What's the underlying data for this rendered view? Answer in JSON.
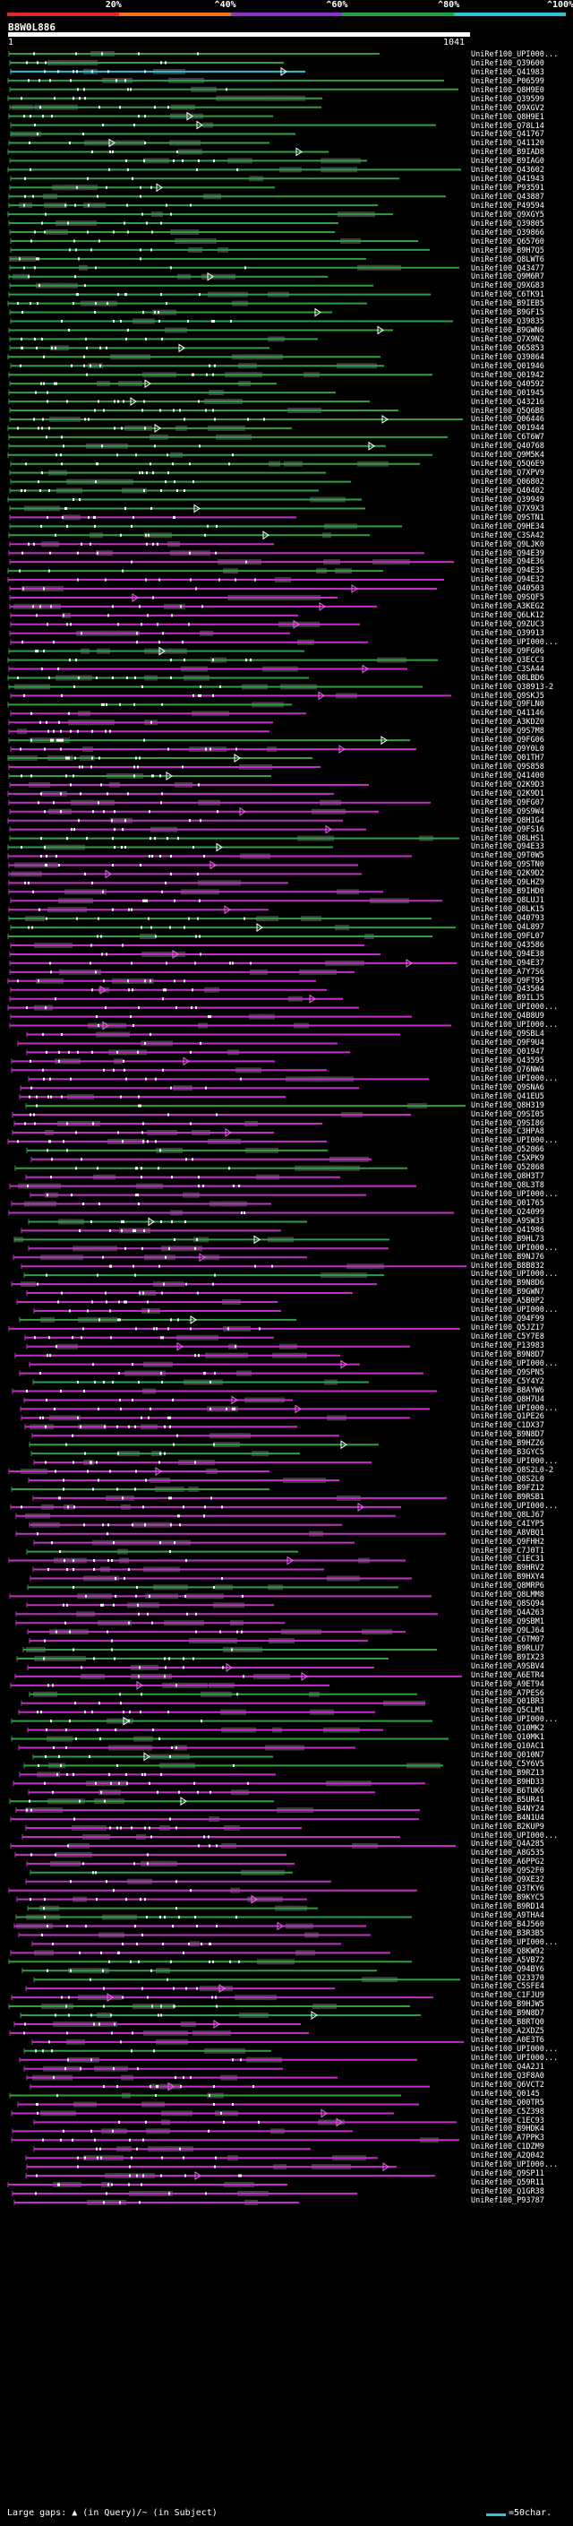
{
  "header": {
    "query_id": "B8W0L886",
    "start": "1",
    "end": "1041"
  },
  "scale": [
    {
      "label": "20%",
      "color": "#e8262a"
    },
    {
      "label": "^40%",
      "color": "#f07a16"
    },
    {
      "label": "^60%",
      "color": "#8a32c9"
    },
    {
      "label": "^80%",
      "color": "#1fa33a"
    },
    {
      "label": "^100%",
      "color": "#2bc6d6"
    }
  ],
  "colors": {
    "high_identity": "#2ea043",
    "low_identity": "#c32fc6",
    "top_hit": "#2bc6d6",
    "gap": "#3c3c3c"
  },
  "legend": {
    "gap_text": "Large gaps: ▲ (in Query)/~ (in Subject)",
    "scale_text": "=50char."
  },
  "hits": [
    "UniRef100_UPI000...",
    "UniRef100_Q39600",
    "UniRef100_Q41983",
    "UniRef100_P06599",
    "UniRef100_Q8H9E0",
    "UniRef100_Q39599",
    "UniRef100_Q9XGV2",
    "UniRef100_Q8H9E1",
    "UniRef100_Q78L14",
    "UniRef100_Q41767",
    "UniRef100_Q41120",
    "UniRef100_B9IAD8",
    "UniRef100_B9IAG0",
    "UniRef100_Q43602",
    "UniRef100_Q41943",
    "UniRef100_P93591",
    "UniRef100_Q43887",
    "UniRef100_P49594",
    "UniRef100_Q9XGY5",
    "UniRef100_Q39805",
    "UniRef100_Q39866",
    "UniRef100_Q65760",
    "UniRef100_B9H7Q5",
    "UniRef100_Q8LWT6",
    "UniRef100_Q43477",
    "UniRef100_Q9M6R7",
    "UniRef100_Q9XG83",
    "UniRef100_C6TK91",
    "UniRef100_B9IEB5",
    "UniRef100_B9GF15",
    "UniRef100_Q39835",
    "UniRef100_B9GWN6",
    "UniRef100_Q7X9N2",
    "UniRef100_Q65853",
    "UniRef100_Q39864",
    "UniRef100_Q01946",
    "UniRef100_Q01942",
    "UniRef100_Q40592",
    "UniRef100_Q01945",
    "UniRef100_Q43216",
    "UniRef100_Q5Q6B8",
    "UniRef100_Q06446",
    "UniRef100_Q01944",
    "UniRef100_C6T6W7",
    "UniRef100_Q40768",
    "UniRef100_Q9M5K4",
    "UniRef100_Q5Q6E9",
    "UniRef100_Q7XPV9",
    "UniRef100_Q06802",
    "UniRef100_Q40402",
    "UniRef100_Q39949",
    "UniRef100_Q7X9X3",
    "UniRef100_Q9STN1",
    "UniRef100_Q9HE34",
    "UniRef100_C3SA42",
    "UniRef100_Q9LJK0",
    "UniRef100_Q94E39",
    "UniRef100_Q94E36",
    "UniRef100_Q94E35",
    "UniRef100_Q94E32",
    "UniRef100_Q40503",
    "UniRef100_Q9SQF5",
    "UniRef100_A3KEG2",
    "UniRef100_Q6LK12",
    "UniRef100_Q9ZUC3",
    "UniRef100_Q39913",
    "UniRef100_UPI000...",
    "UniRef100_Q9FG06",
    "UniRef100_Q3ECC3",
    "UniRef100_C3SA44",
    "UniRef100_Q8LBD6",
    "UniRef100_Q38913-2",
    "UniRef100_Q9SKJ5",
    "UniRef100_Q9FLN0",
    "UniRef100_Q41146",
    "UniRef100_A3KDZ0",
    "UniRef100_Q9S7M8",
    "UniRef100_Q9FG06",
    "UniRef100_Q9Y0L0",
    "UniRef100_Q01TH7",
    "UniRef100_Q9S858",
    "UniRef100_Q41400",
    "UniRef100_Q2K9D3",
    "UniRef100_Q2K9D1",
    "UniRef100_Q9FG07",
    "UniRef100_Q9S9W4",
    "UniRef100_Q8H1G4",
    "UniRef100_Q9FS16",
    "UniRef100_Q8LHS1",
    "UniRef100_Q94E33",
    "UniRef100_Q9T0W5",
    "UniRef100_Q9STN0",
    "UniRef100_Q2K9D2",
    "UniRef100_Q9LHZ9",
    "UniRef100_B9IHD0",
    "UniRef100_Q8LUJ1",
    "UniRef100_Q8LK15",
    "UniRef100_Q40793",
    "UniRef100_Q4L897",
    "UniRef100_Q9FL07",
    "UniRef100_Q43586",
    "UniRef100_Q94E38",
    "UniRef100_Q94E37",
    "UniRef100_A7Y7S6",
    "UniRef100_Q9FT95",
    "UniRef100_Q43504",
    "UniRef100_B9ILJ5",
    "UniRef100_UPI000...",
    "UniRef100_Q4B8U9",
    "UniRef100_UPI000...",
    "UniRef100_Q9SBL4",
    "UniRef100_Q9F9U4",
    "UniRef100_Q01947",
    "UniRef100_Q43595",
    "UniRef100_Q76NW4",
    "UniRef100_UPI000...",
    "UniRef100_Q9SNA6",
    "UniRef100_Q41EU5",
    "UniRef100_Q8H319",
    "UniRef100_Q9SI05",
    "UniRef100_Q9SI86",
    "UniRef100_C3HPA8",
    "UniRef100_UPI000...",
    "UniRef100_Q52066",
    "UniRef100_C5XPK9",
    "UniRef100_Q52868",
    "UniRef100_Q8H3T7",
    "UniRef100_Q8L3T8",
    "UniRef100_UPI000...",
    "UniRef100_Q01765",
    "UniRef100_Q24099",
    "UniRef100_A9SW33",
    "UniRef100_Q41986",
    "UniRef100_B9HL73",
    "UniRef100_UPI000...",
    "UniRef100_B9NJ76",
    "UniRef100_B8B832",
    "UniRef100_UPI000...",
    "UniRef100_B9N8D6",
    "UniRef100_B9GWN7",
    "UniRef100_A5B0P2",
    "UniRef100_UPI000...",
    "UniRef100_Q94F99",
    "UniRef100_Q5JZ17",
    "UniRef100_C5Y7E8",
    "UniRef100_P13983",
    "UniRef100_B9N8D7",
    "UniRef100_UPI000...",
    "UniRef100_Q9SPN5",
    "UniRef100_C5Y4Y2",
    "UniRef100_B8AYW6",
    "UniRef100_Q8H7U4",
    "UniRef100_UPI000...",
    "UniRef100_Q1PE26",
    "UniRef100_C1DX37",
    "UniRef100_B9N8D7",
    "UniRef100_B9HZZ6",
    "UniRef100_B3GYC5",
    "UniRef100_UPI000...",
    "UniRef100_Q8S2L0-2",
    "UniRef100_Q8S2L0",
    "UniRef100_B9FZ12",
    "UniRef100_B9RSB1",
    "UniRef100_UPI000...",
    "UniRef100_Q8LJ67",
    "UniRef100_C4IYP5",
    "UniRef100_A8VBQ1",
    "UniRef100_Q9FHH2",
    "UniRef100_C7J0T1",
    "UniRef100_C1EC31",
    "UniRef100_B9HRV2",
    "UniRef100_B9HXY4",
    "UniRef100_Q8MRP6",
    "UniRef100_Q8LMM8",
    "UniRef100_Q8SQ94",
    "UniRef100_Q4A263",
    "UniRef100_Q9SBM1",
    "UniRef100_Q9LJ64",
    "UniRef100_C6TM07",
    "UniRef100_B9RLU7",
    "UniRef100_B9IX23",
    "UniRef100_A9SBV4",
    "UniRef100_A6ETR4",
    "UniRef100_A9ET94",
    "UniRef100_A7PES6",
    "UniRef100_Q01BR3",
    "UniRef100_Q5CLM1",
    "UniRef100_UPI000...",
    "UniRef100_Q10MK2",
    "UniRef100_Q10MK1",
    "UniRef100_Q10AC1",
    "UniRef100_Q010N7",
    "UniRef100_C5Y6V5",
    "UniRef100_B9RZ13",
    "UniRef100_B9HD33",
    "UniRef100_B6TUK6",
    "UniRef100_B5UR41",
    "UniRef100_B4NY24",
    "UniRef100_B4N1U4",
    "UniRef100_B2KUP9",
    "UniRef100_UPI000...",
    "UniRef100_Q4A285",
    "UniRef100_A8G535",
    "UniRef100_A6PPG2",
    "UniRef100_Q9S2F0",
    "UniRef100_Q9XE32",
    "UniRef100_Q3TKY6",
    "UniRef100_B9KYC5",
    "UniRef100_B9RD14",
    "UniRef100_A9THA4",
    "UniRef100_B4J560",
    "UniRef100_B3R3B5",
    "UniRef100_UPI000...",
    "UniRef100_Q8KW92",
    "UniRef100_A5VB72",
    "UniRef100_Q94BY6",
    "UniRef100_Q23370",
    "UniRef100_C5SFE4",
    "UniRef100_C1FJU9",
    "UniRef100_B9HJW5",
    "UniRef100_B9N8D7",
    "UniRef100_B8RTQ0",
    "UniRef100_A2XDZ5",
    "UniRef100_A0E3T6",
    "UniRef100_UPI000...",
    "UniRef100_UPI000...",
    "UniRef100_Q4A2J1",
    "UniRef100_Q3F8A0",
    "UniRef100_Q6VCT2",
    "UniRef100_Q0145",
    "UniRef100_Q00TR5",
    "UniRef100_C5Z398",
    "UniRef100_C1EC93",
    "UniRef100_B9HDK4",
    "UniRef100_A7PPK3",
    "UniRef100_C1DZM9",
    "UniRef100_A2Q042",
    "UniRef100_UPI000...",
    "UniRef100_Q9SP11",
    "UniRef100_Q59R11",
    "UniRef100_Q1GR38",
    "UniRef100_P93787"
  ]
}
